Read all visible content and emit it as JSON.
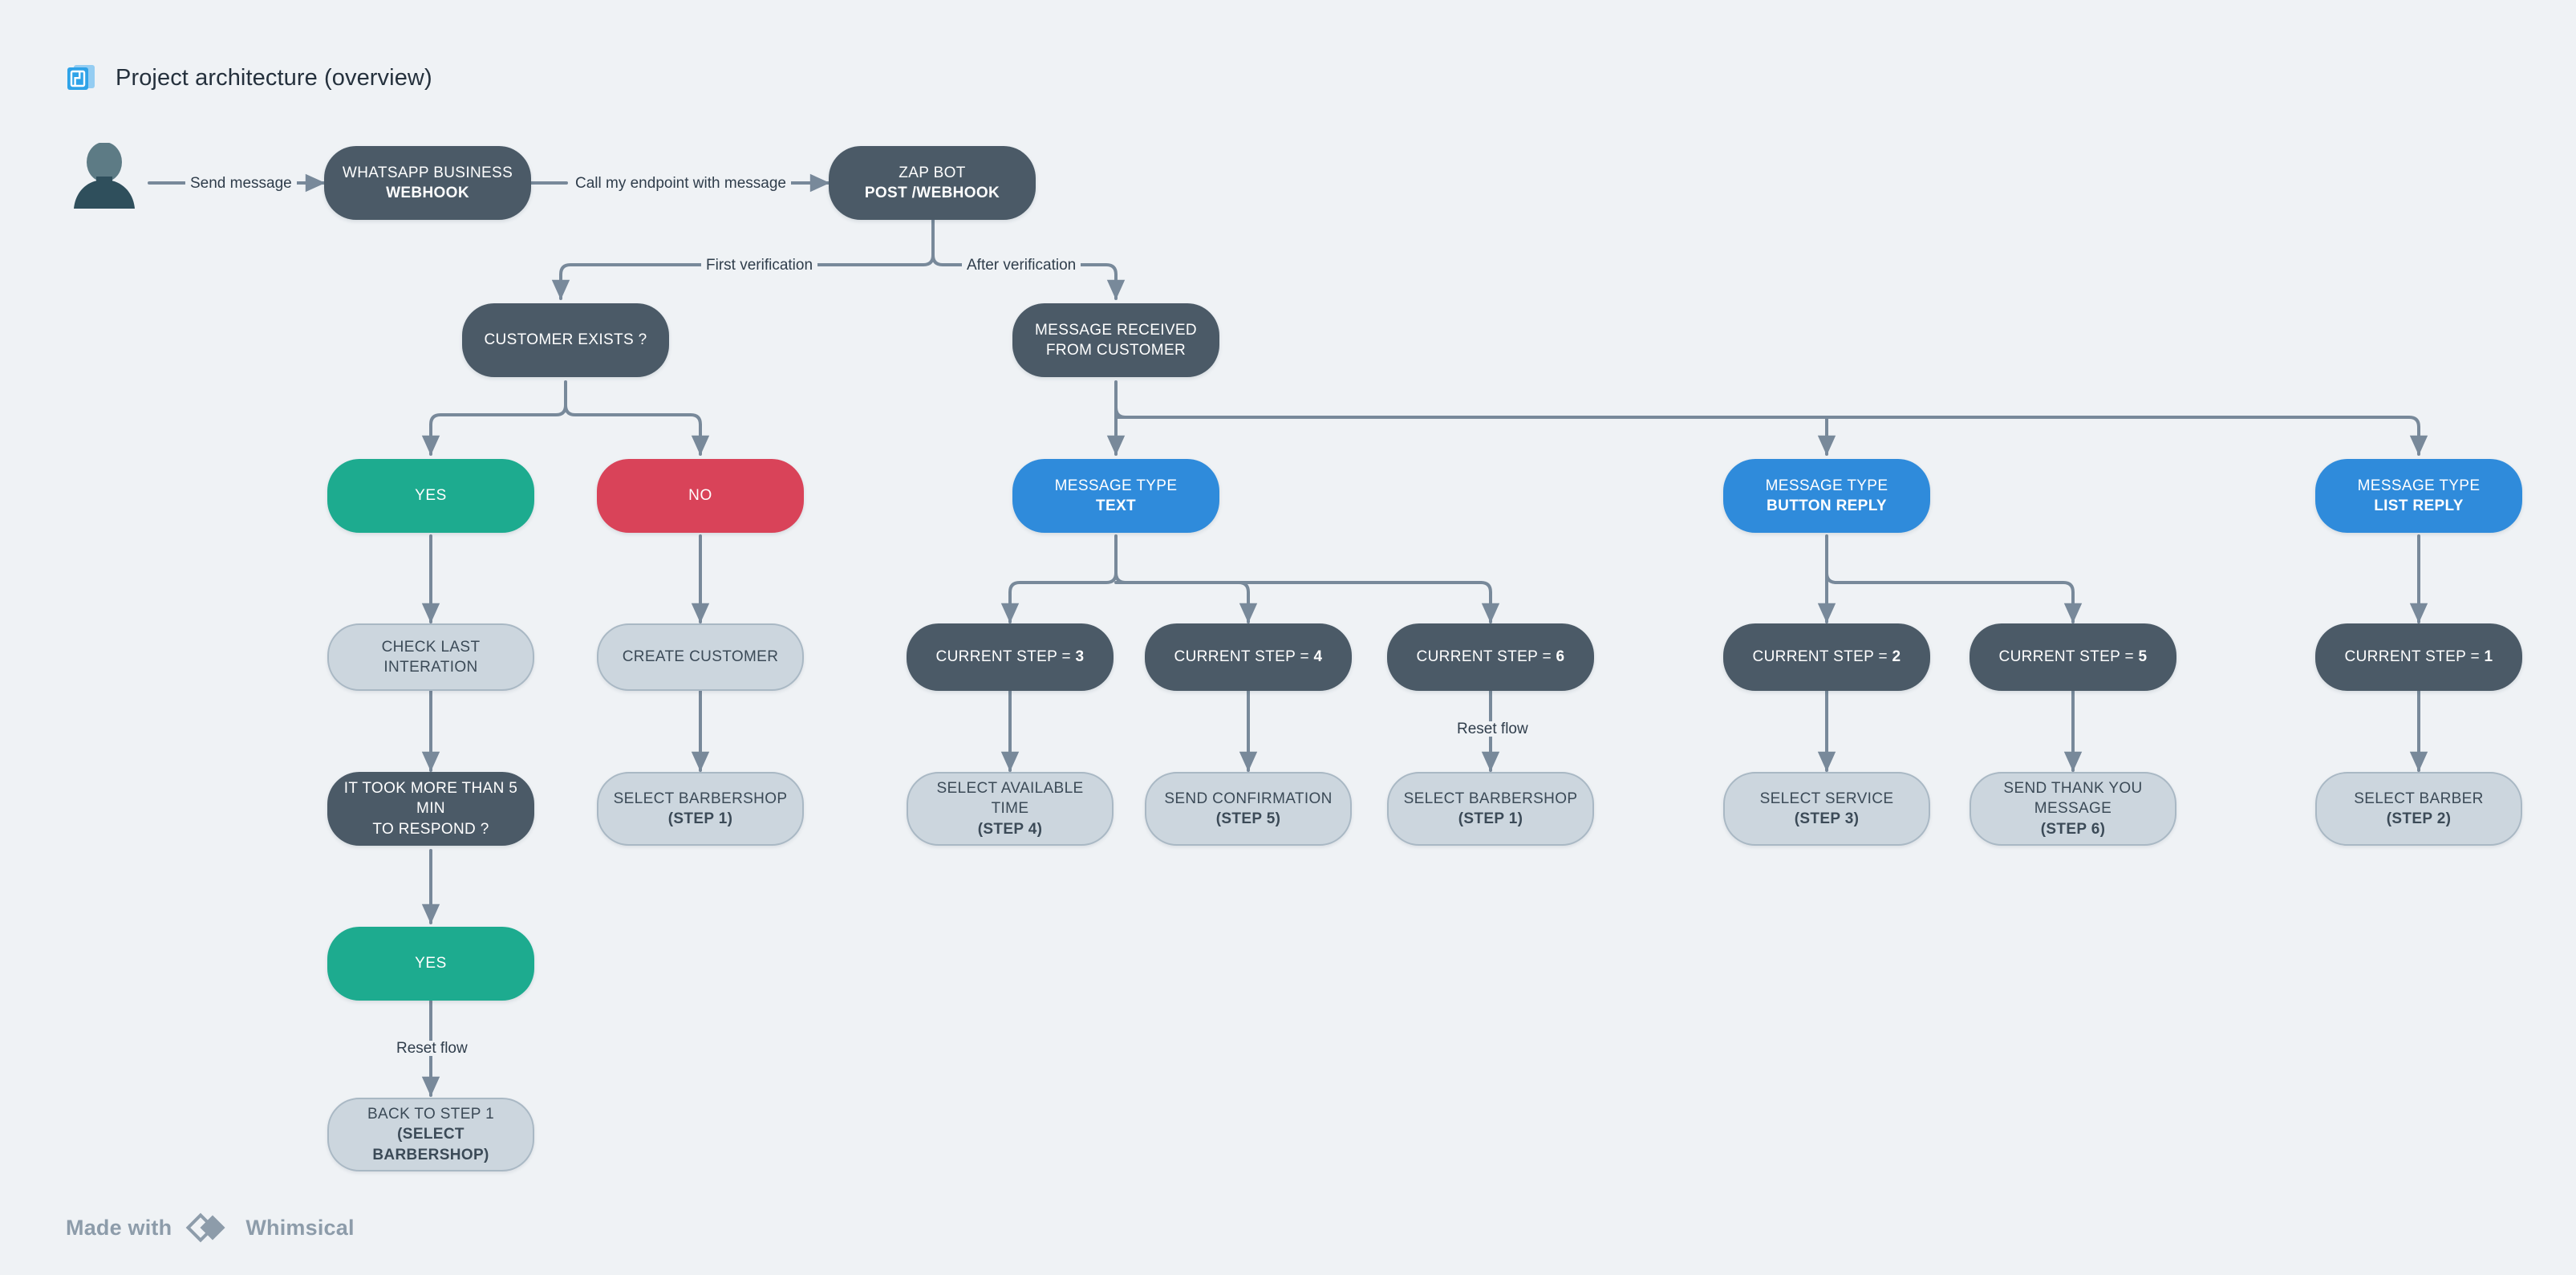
{
  "header": {
    "icon": "blueprint-icon",
    "title": "Project architecture (overview)"
  },
  "footer": {
    "made_with": "Made with",
    "brand": "Whimsical",
    "logo_icon": "whimsical-diamond-icon"
  },
  "colors": {
    "background": "#eff2f5",
    "dark_node": "#4b5a67",
    "light_node": "#ccd6de",
    "light_node_border": "#a9b8c4",
    "blue_node": "#2f8bdb",
    "green_node": "#1dab8f",
    "red_node": "#d94359",
    "connector": "#78899a",
    "title_text": "#25313d",
    "footer_text": "#8d9caa",
    "icon_blue": "#2fa3e8"
  },
  "actor": {
    "name": "person-avatar",
    "label": ""
  },
  "nodes": [
    {
      "id": "whatsapp-business-webhook",
      "style": "dark",
      "line1": "WHATSAPP BUSINESS",
      "line2": "WEBHOOK"
    },
    {
      "id": "zap-bot-post-webhook",
      "style": "dark",
      "line1": "ZAP BOT",
      "line2": "POST /WEBHOOK"
    },
    {
      "id": "customer-exists",
      "style": "dark",
      "line1": "CUSTOMER EXISTS ?",
      "line2": ""
    },
    {
      "id": "message-received-from-customer",
      "style": "dark",
      "line1": "MESSAGE RECEIVED",
      "line2b": "FROM CUSTOMER"
    },
    {
      "id": "yes-customer-exists",
      "style": "green",
      "line1": "YES",
      "line2": ""
    },
    {
      "id": "no-customer-exists",
      "style": "red",
      "line1": "NO",
      "line2": ""
    },
    {
      "id": "check-last-interation",
      "style": "light",
      "line1": "CHECK LAST INTERATION",
      "line2": ""
    },
    {
      "id": "create-customer",
      "style": "light",
      "line1": "CREATE CUSTOMER",
      "line2": ""
    },
    {
      "id": "took-more-than-5-min",
      "style": "dark",
      "line1": "IT TOOK MORE THAN 5 MIN",
      "line2b": "TO RESPOND ?"
    },
    {
      "id": "select-barbershop-step-1-left",
      "style": "light",
      "line1": "SELECT BARBERSHOP",
      "line2": "(STEP 1)"
    },
    {
      "id": "yes-took-more-than-5-min",
      "style": "green",
      "line1": "YES",
      "line2": ""
    },
    {
      "id": "back-to-step-1",
      "style": "light",
      "line1": "BACK TO STEP 1",
      "line2": "(SELECT BARBERSHOP)"
    },
    {
      "id": "message-type-text",
      "style": "blue",
      "line1": "MESSAGE TYPE",
      "line2": "TEXT"
    },
    {
      "id": "message-type-button-reply",
      "style": "blue",
      "line1": "MESSAGE TYPE",
      "line2": "BUTTON REPLY"
    },
    {
      "id": "message-type-list-reply",
      "style": "blue",
      "line1": "MESSAGE TYPE",
      "line2": "LIST REPLY"
    },
    {
      "id": "current-step-3",
      "style": "dark",
      "line1": "CURRENT STEP = ",
      "line2i": "3"
    },
    {
      "id": "current-step-4",
      "style": "dark",
      "line1": "CURRENT STEP = ",
      "line2i": "4"
    },
    {
      "id": "current-step-6",
      "style": "dark",
      "line1": "CURRENT STEP = ",
      "line2i": "6"
    },
    {
      "id": "current-step-2",
      "style": "dark",
      "line1": "CURRENT STEP = ",
      "line2i": "2"
    },
    {
      "id": "current-step-5",
      "style": "dark",
      "line1": "CURRENT STEP = ",
      "line2i": "5"
    },
    {
      "id": "current-step-1",
      "style": "dark",
      "line1": "CURRENT STEP = ",
      "line2i": "1"
    },
    {
      "id": "select-available-time",
      "style": "light",
      "line1": "SELECT AVAILABLE TIME",
      "line2": "(STEP 4)"
    },
    {
      "id": "send-confirmation",
      "style": "light",
      "line1": "SEND CONFIRMATION",
      "line2": "(STEP 5)"
    },
    {
      "id": "select-barbershop-step-1-mid",
      "style": "light",
      "line1": "SELECT BARBERSHOP",
      "line2": "(STEP 1)"
    },
    {
      "id": "select-service",
      "style": "light",
      "line1": "SELECT SERVICE",
      "line2": "(STEP 3)"
    },
    {
      "id": "send-thank-you-message",
      "style": "light",
      "line1": "SEND THANK YOU MESSAGE",
      "line2": "(STEP 6)"
    },
    {
      "id": "select-barber",
      "style": "light",
      "line1": "SELECT BARBER",
      "line2": "(STEP 2)"
    }
  ],
  "labels": {
    "send_message": "Send message",
    "call_endpoint": "Call my endpoint with message",
    "first_verification": "First verification",
    "after_verification": "After verification",
    "reset_flow_left": "Reset flow",
    "reset_flow_mid": "Reset flow"
  },
  "nodeText": {
    "whatsapp_l1": "WHATSAPP BUSINESS",
    "whatsapp_l2": "WEBHOOK",
    "zapbot_l1": "ZAP BOT",
    "zapbot_l2": "POST /WEBHOOK",
    "customer_exists": "CUSTOMER EXISTS ?",
    "msg_recv_l1": "MESSAGE RECEIVED",
    "msg_recv_l2": "FROM CUSTOMER",
    "yes1": "YES",
    "no1": "NO",
    "check_last": "CHECK LAST INTERATION",
    "create_customer": "CREATE CUSTOMER",
    "took5_l1": "IT TOOK MORE THAN 5 MIN",
    "took5_l2": "TO RESPOND ?",
    "sel_barbershop_left_l1": "SELECT BARBERSHOP",
    "sel_barbershop_left_l2": "(STEP 1)",
    "yes2": "YES",
    "back_l1": "BACK TO STEP 1",
    "back_l2": "(SELECT BARBERSHOP)",
    "mt_l1": "MESSAGE TYPE",
    "mt_text": "TEXT",
    "mt_button": "BUTTON REPLY",
    "mt_list": "LIST REPLY",
    "cs_prefix": "CURRENT STEP = ",
    "cs3": "3",
    "cs4": "4",
    "cs6": "6",
    "cs2": "2",
    "cs5": "5",
    "cs1": "1",
    "sel_time_l1": "SELECT AVAILABLE TIME",
    "sel_time_l2": "(STEP 4)",
    "send_conf_l1": "SEND CONFIRMATION",
    "send_conf_l2": "(STEP 5)",
    "sel_barbershop_mid_l1": "SELECT BARBERSHOP",
    "sel_barbershop_mid_l2": "(STEP 1)",
    "sel_service_l1": "SELECT SERVICE",
    "sel_service_l2": "(STEP 3)",
    "thankyou_l1": "SEND THANK YOU MESSAGE",
    "thankyou_l2": "(STEP 6)",
    "sel_barber_l1": "SELECT BARBER",
    "sel_barber_l2": "(STEP 2)"
  }
}
